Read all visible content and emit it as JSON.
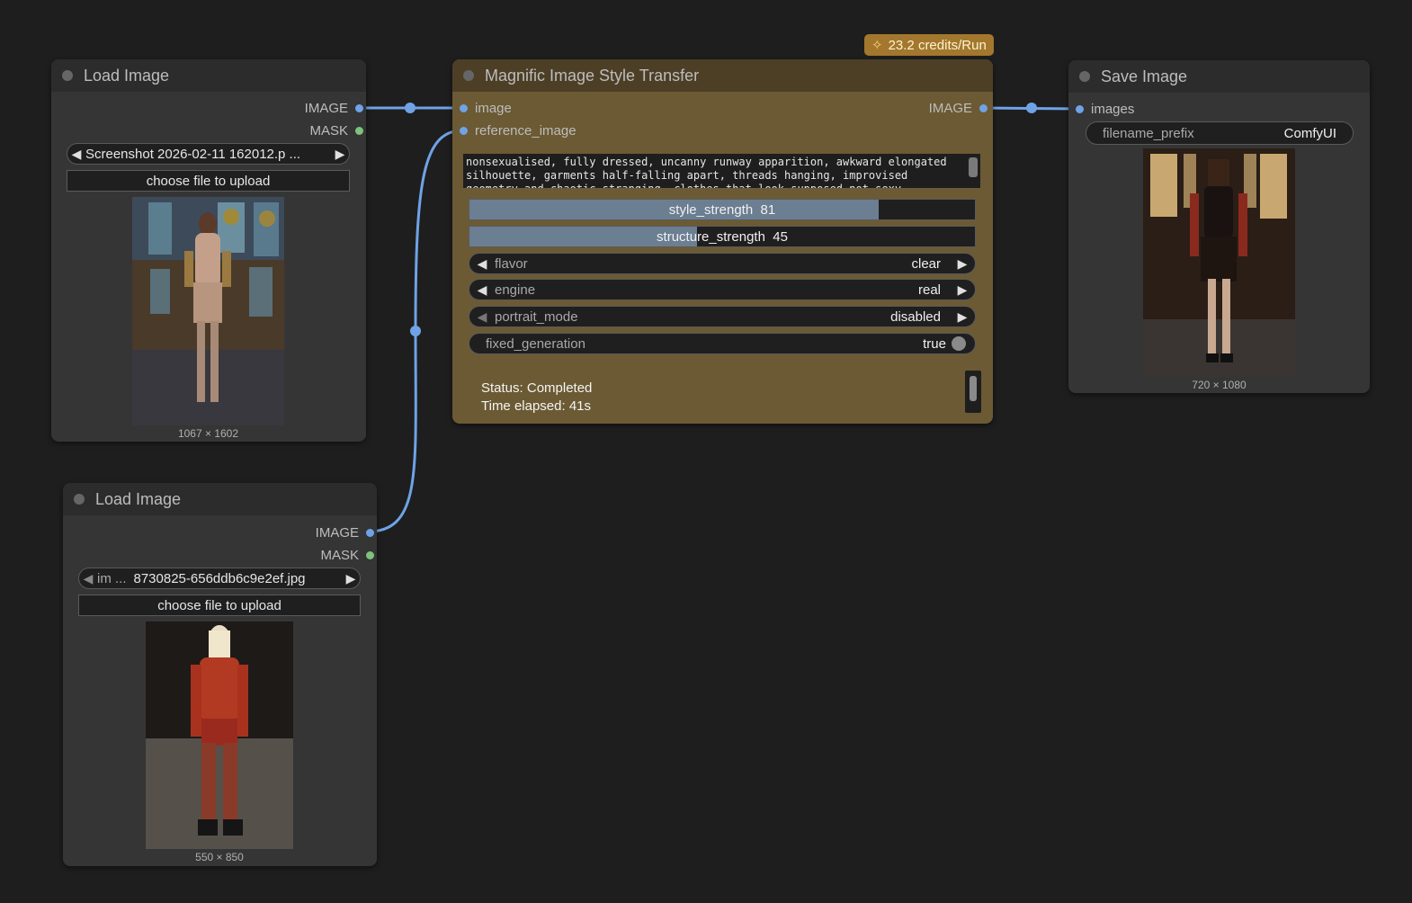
{
  "load_image_1": {
    "title": "Load Image",
    "out_image": "IMAGE",
    "out_mask": "MASK",
    "file": "Screenshot 2026-02-11 162012.p ...",
    "upload_label": "choose file to upload",
    "dimensions": "1067 × 1602"
  },
  "load_image_2": {
    "title": "Load Image",
    "out_image": "IMAGE",
    "out_mask": "MASK",
    "file_prefix": "im ...",
    "file": "8730825-656ddb6c9e2ef.jpg",
    "upload_label": "choose file to upload",
    "dimensions": "550 × 850"
  },
  "magnific": {
    "title": "Magnific Image Style Transfer",
    "badge": "23.2 credits/Run",
    "in_image": "image",
    "in_reference": "reference_image",
    "out_image": "IMAGE",
    "prompt": "nonsexualised, fully dressed, uncanny runway apparition, awkward elongated silhouette, garments half-falling apart, threads hanging, improvised geometry and chaotic stranging, clothes that look supposed not sexy",
    "style_strength": {
      "label": "style_strength",
      "value": "81",
      "fraction": 0.81
    },
    "structure_strength": {
      "label": "structure_strength",
      "value": "45",
      "fraction": 0.45
    },
    "flavor": {
      "label": "flavor",
      "value": "clear"
    },
    "engine": {
      "label": "engine",
      "value": "real"
    },
    "portrait_mode": {
      "label": "portrait_mode",
      "value": "disabled"
    },
    "fixed_generation": {
      "label": "fixed_generation",
      "value": "true"
    },
    "status": "Status: Completed",
    "elapsed": "Time elapsed: 41s"
  },
  "save_image": {
    "title": "Save Image",
    "in_images": "images",
    "prefix_label": "filename_prefix",
    "prefix_value": "ComfyUI",
    "dimensions": "720 × 1080"
  },
  "colors": {
    "link": "#6fa3e6",
    "magnific_body": "#6b5a33",
    "badge": "#a3782e"
  }
}
